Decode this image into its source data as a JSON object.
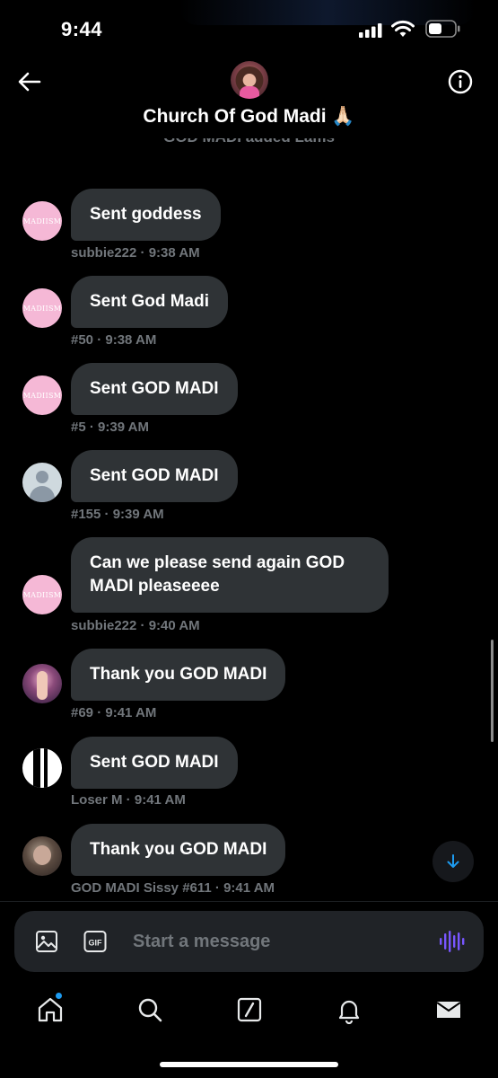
{
  "status_bar": {
    "time": "9:44"
  },
  "header": {
    "title": "Church Of God Madi 🙏🏻"
  },
  "system_notice": "GOD MADI added Lams",
  "messages": [
    {
      "avatar_text": "MADIISM",
      "text": "Sent goddess",
      "sender": "subbie222",
      "time": "9:38 AM"
    },
    {
      "avatar_text": "MADIISM",
      "text": "Sent God Madi",
      "sender": "#50",
      "time": "9:38 AM"
    },
    {
      "avatar_text": "MADIISM",
      "text": "Sent GOD MADI",
      "sender": "#5",
      "time": "9:39 AM"
    },
    {
      "avatar_text": "",
      "text": "Sent GOD MADI",
      "sender": "#155",
      "time": "9:39 AM"
    },
    {
      "avatar_text": "MADIISM",
      "text_line1": "Can we please send again GOD",
      "text_line2": "MADI pleaseeee",
      "sender": "subbie222",
      "time": "9:40 AM"
    },
    {
      "avatar_text": "",
      "text": "Thank you GOD MADI",
      "sender": "#69",
      "time": "9:41 AM"
    },
    {
      "avatar_text": "",
      "text": "Sent GOD MADI",
      "sender": "Loser M",
      "time": "9:41 AM"
    },
    {
      "avatar_text": "",
      "text": "Thank you GOD MADI",
      "sender": "GOD MADI Sissy #611",
      "time": "9:41 AM"
    }
  ],
  "meta_separator": " · ",
  "composer": {
    "placeholder": "Start a message",
    "gif_label": "GIF"
  },
  "colors": {
    "accent": "#1d9bf0",
    "bubble": "#2f3336",
    "voice": "#7856ff",
    "background": "#000000"
  },
  "icons": [
    "back-arrow-icon",
    "info-icon",
    "image-icon",
    "gif-icon",
    "voice-wave-icon",
    "home-icon",
    "search-icon",
    "grok-icon",
    "bell-icon",
    "mail-icon",
    "arrow-down-icon"
  ]
}
